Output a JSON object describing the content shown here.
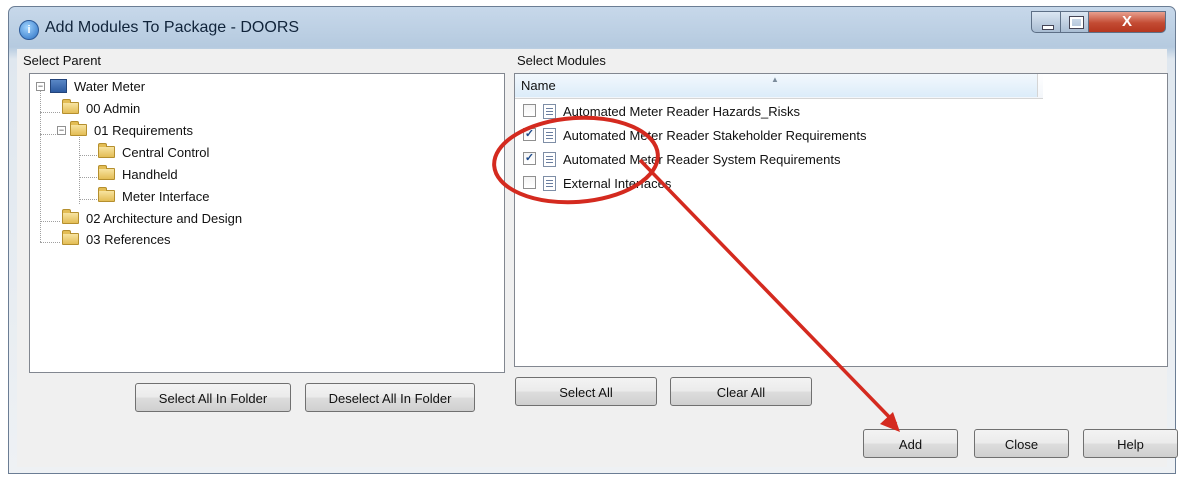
{
  "window": {
    "title": "Add Modules To Package - DOORS",
    "app_icon_glyph": "i",
    "close_glyph": "X"
  },
  "select_parent": {
    "label": "Select Parent",
    "tree": [
      {
        "label": "Water Meter",
        "icon": "database-icon",
        "expander": "−"
      },
      {
        "label": "00 Admin",
        "icon": "folder-icon"
      },
      {
        "label": "01 Requirements",
        "icon": "folder-icon",
        "expander": "−"
      },
      {
        "label": "Central Control",
        "icon": "folder-icon"
      },
      {
        "label": "Handheld",
        "icon": "folder-icon"
      },
      {
        "label": "Meter Interface",
        "icon": "folder-icon"
      },
      {
        "label": "02 Architecture and Design",
        "icon": "folder-icon",
        "expander": "+"
      },
      {
        "label": "03 References",
        "icon": "folder-icon"
      }
    ],
    "select_all_in_folder": "Select All In Folder",
    "deselect_all_in_folder": "Deselect All In Folder"
  },
  "select_modules": {
    "label": "Select Modules",
    "column_header": "Name",
    "sort_glyph": "▲",
    "check_glyph": "✓",
    "modules": [
      {
        "label": "Automated Meter Reader Hazards_Risks",
        "checked": false
      },
      {
        "label": "Automated Meter Reader Stakeholder Requirements",
        "checked": true
      },
      {
        "label": "Automated Meter Reader System Requirements",
        "checked": true
      },
      {
        "label": "External Interfaces",
        "checked": false
      }
    ],
    "select_all": "Select All",
    "clear_all": "Clear All"
  },
  "footer": {
    "add": "Add",
    "close": "Close",
    "help": "Help"
  },
  "annotation": {
    "color": "#d42a1f"
  }
}
